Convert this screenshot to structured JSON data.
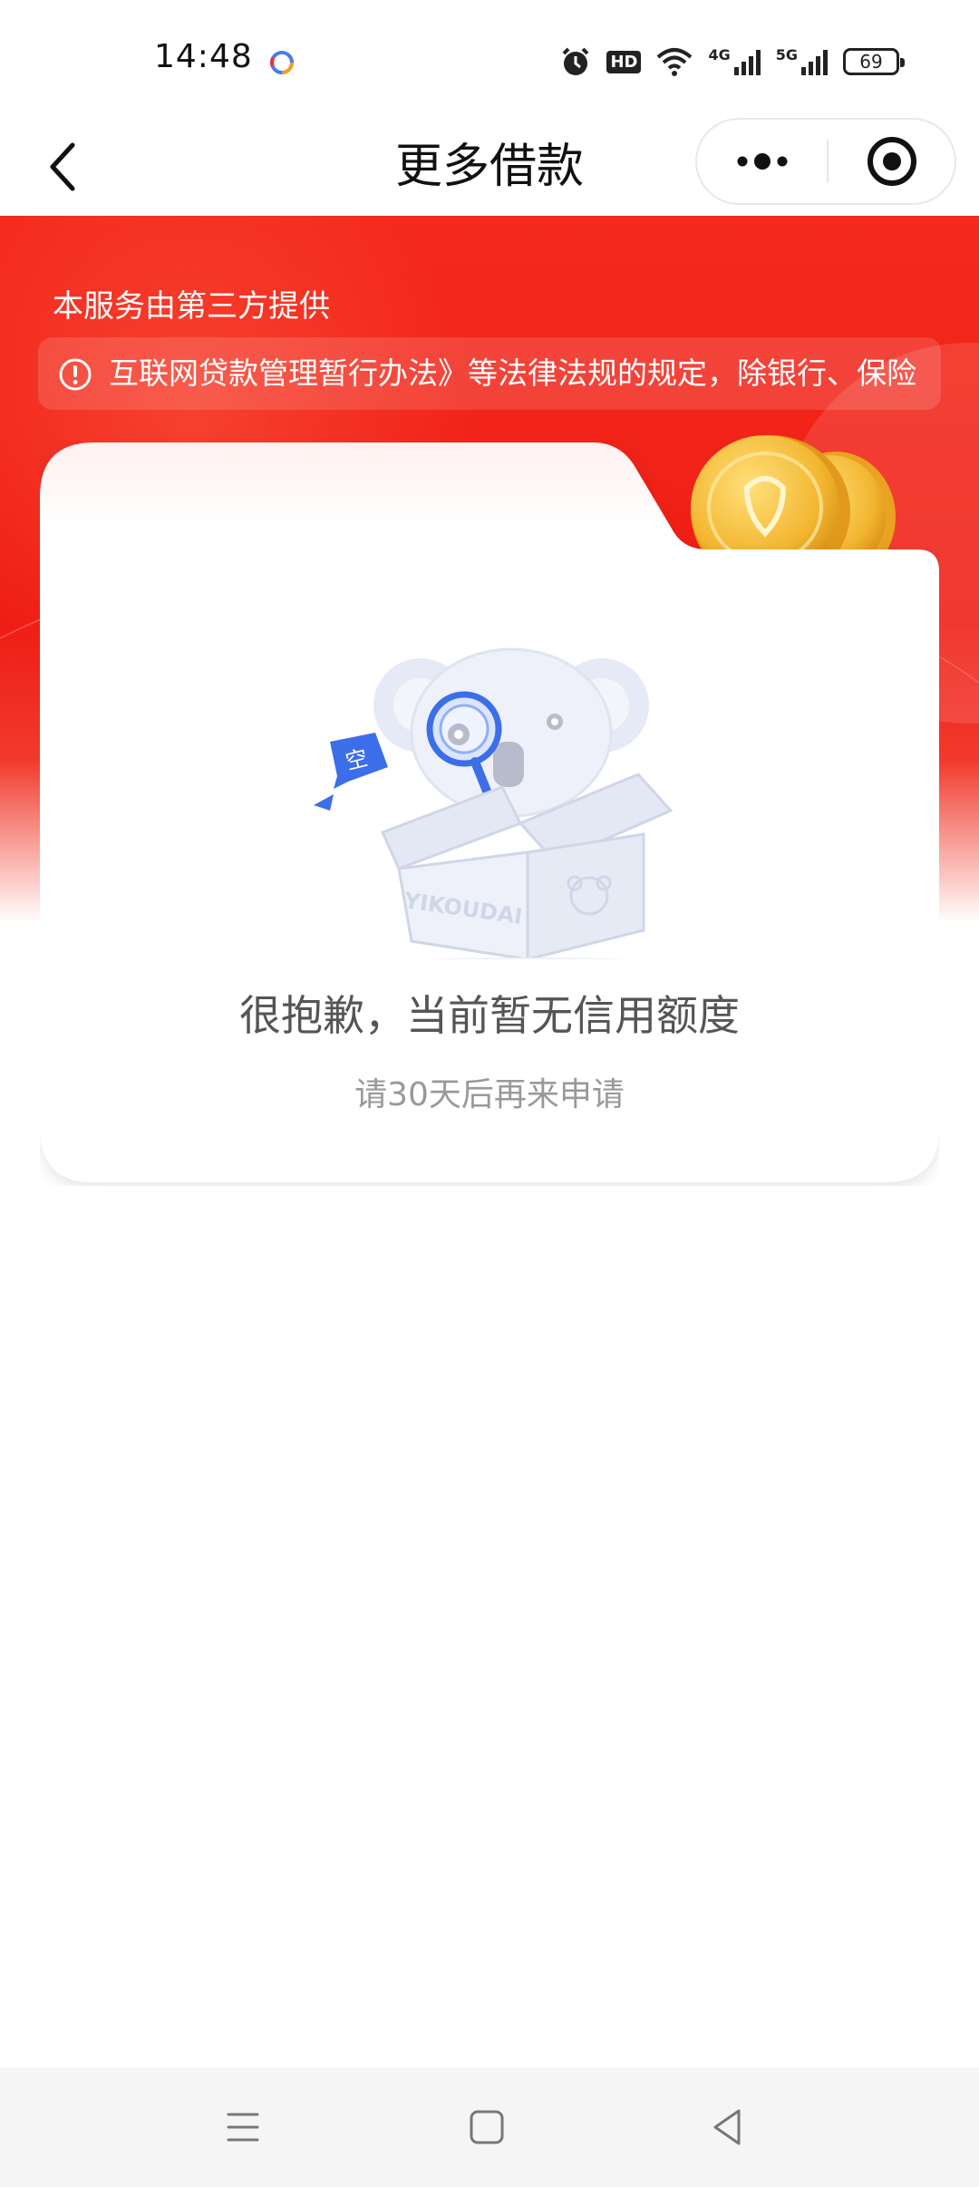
{
  "status_bar": {
    "time": "14:48",
    "hd_label": "HD",
    "net1_label": "4G",
    "net2_label": "5G",
    "battery_level": "69",
    "icons": [
      "baidu-icon",
      "alarm-icon",
      "hd-icon",
      "wifi-icon",
      "signal-4g-icon",
      "signal-5g-icon",
      "battery-icon"
    ]
  },
  "nav": {
    "title": "更多借款",
    "icons": [
      "back-chevron-icon",
      "more-dots-icon",
      "close-target-icon"
    ]
  },
  "banner": {
    "provider_note": "本服务由第三方提供",
    "notice_text": "互联网贷款管理暂行办法》等法律法规的规定，除银行、保险",
    "notice_icon": "warning-circle-icon"
  },
  "card": {
    "illustration_badge": "空",
    "illustration_box_label": "YIKOUDAI",
    "empty_title": "很抱歉，当前暂无信用额度",
    "empty_subtitle": "请30天后再来申请"
  },
  "system_nav": {
    "icons": [
      "menu-lines-icon",
      "home-square-icon",
      "back-triangle-icon"
    ]
  },
  "colors": {
    "brand_red": "#ef1d14",
    "title_gray": "#555555",
    "subtitle_gray": "#999999",
    "illustration_blue": "#3b6ee8"
  }
}
